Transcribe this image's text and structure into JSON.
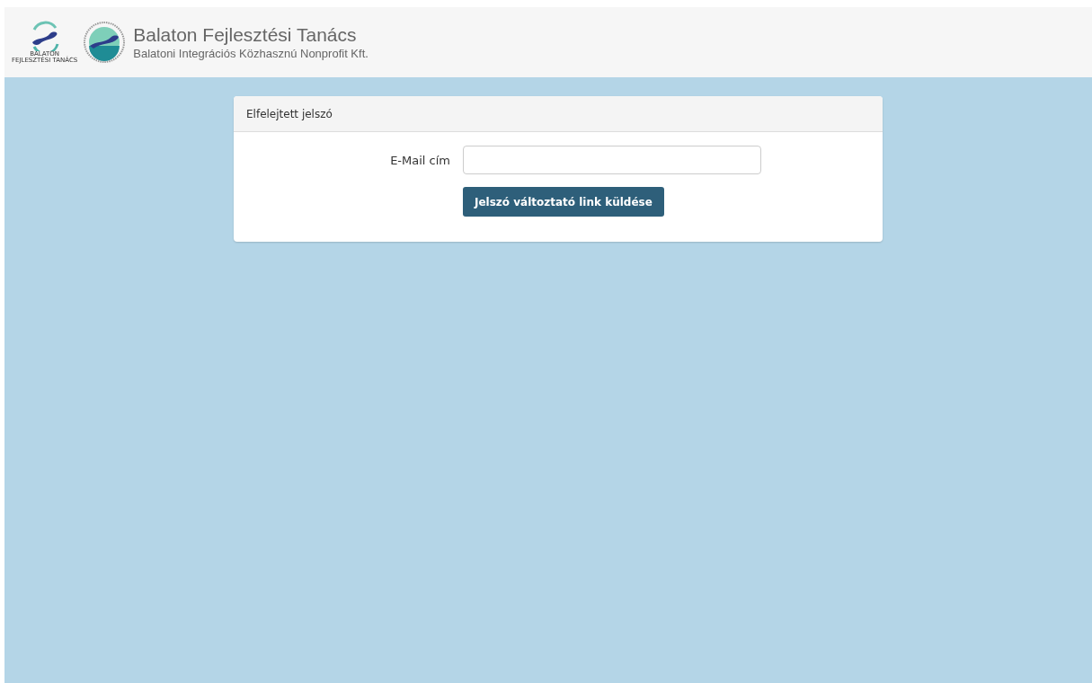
{
  "header": {
    "title": "Balaton Fejlesztési Tanács",
    "subtitle": "Balatoni Integrációs Közhasznú Nonprofit Kft.",
    "logo_caption": [
      "BALATON",
      "FEJLESZTÉSI TANÁCS"
    ]
  },
  "card": {
    "title": "Elfelejtett jelszó",
    "field": {
      "label": "E-Mail cím"
    },
    "button": "Jelszó változtató link küldése"
  }
}
